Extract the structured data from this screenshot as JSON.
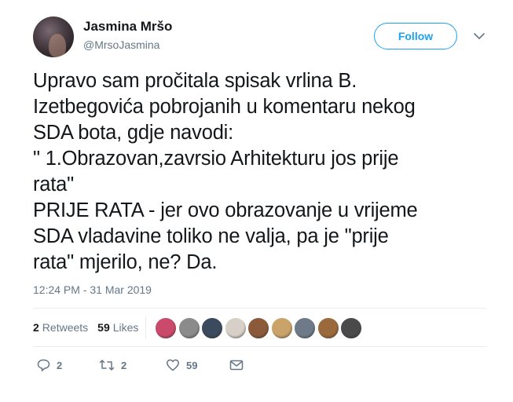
{
  "author": {
    "name": "Jasmina Mršo",
    "handle": "@MrsoJasmina"
  },
  "follow_label": "Follow",
  "tweet_text": "Upravo sam pročitala spisak vrlina B.\nIzetbegovića pobrojanih u komentaru nekog\nSDA bota, gdje navodi:\n\" 1.Obrazovan,zavrsio Arhitekturu jos prije\nrata\"\nPRIJE RATA - jer ovo obrazovanje u vrijeme\nSDA vladavine toliko ne valja, pa je \"prije\nrata\" mjerilo, ne? Da.",
  "timestamp": "12:24 PM - 31 Mar 2019",
  "stats": {
    "retweets_count": "2",
    "retweets_label": "Retweets",
    "likes_count": "59",
    "likes_label": "Likes"
  },
  "liker_avatar_colors": [
    "#c94a6a",
    "#8b8b8b",
    "#3b4a5c",
    "#d7d0c8",
    "#8a5a3a",
    "#c9a36a",
    "#6e7a88",
    "#9a6a3c",
    "#4a4a4a"
  ],
  "actions": {
    "reply_count": "2",
    "retweet_count": "2",
    "like_count": "59"
  },
  "colors": {
    "accent": "#1da1f2",
    "secondary_text": "#657786",
    "primary_text": "#14171a",
    "divider": "#e6ecf0"
  }
}
